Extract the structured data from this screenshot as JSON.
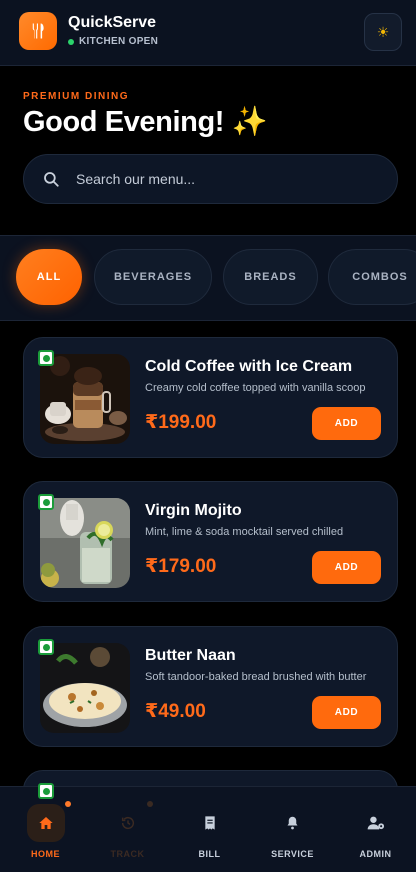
{
  "header": {
    "app_title": "QuickServe",
    "status": "KITCHEN OPEN",
    "status_color": "#2bd36b",
    "accent": "#ff6a1a"
  },
  "hero": {
    "eyebrow": "PREMIUM DINING",
    "greeting": "Good Evening!",
    "greeting_emoji": "✨"
  },
  "search": {
    "placeholder": "Search our menu..."
  },
  "categories": [
    {
      "label": "ALL",
      "active": true
    },
    {
      "label": "BEVERAGES",
      "active": false
    },
    {
      "label": "BREADS",
      "active": false
    },
    {
      "label": "COMBOS",
      "active": false
    }
  ],
  "menu_items": [
    {
      "name": "Cold Coffee with Ice Cream",
      "description": "Creamy cold coffee topped with vanilla scoop",
      "price": "₹199.00",
      "add_label": "ADD",
      "veg": true
    },
    {
      "name": "Virgin Mojito",
      "description": "Mint, lime & soda mocktail served chilled",
      "price": "₹179.00",
      "add_label": "ADD",
      "veg": true
    },
    {
      "name": "Butter Naan",
      "description": "Soft tandoor-baked bread brushed with butter",
      "price": "₹49.00",
      "add_label": "ADD",
      "veg": true
    }
  ],
  "bottom_nav": [
    {
      "label": "HOME",
      "icon": "home-icon",
      "active": true
    },
    {
      "label": "TRACK",
      "icon": "history-icon",
      "active": false
    },
    {
      "label": "BILL",
      "icon": "receipt-icon",
      "active": false
    },
    {
      "label": "SERVICE",
      "icon": "bell-icon",
      "active": false
    },
    {
      "label": "ADMIN",
      "icon": "admin-user-icon",
      "active": false
    }
  ]
}
